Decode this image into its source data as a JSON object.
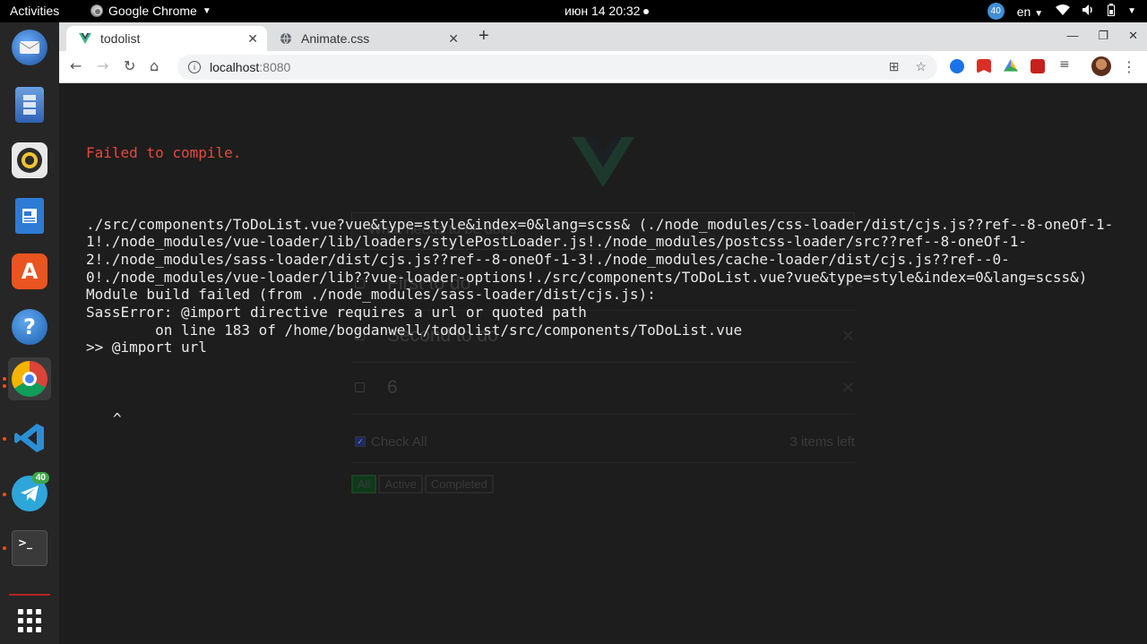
{
  "topbar": {
    "activities": "Activities",
    "app_name": "Google Chrome",
    "clock": "июн 14  20:32",
    "notifications": "40",
    "lang": "en"
  },
  "dock": {
    "telegram_badge": "40"
  },
  "browser": {
    "tabs": [
      {
        "title": "todolist"
      },
      {
        "title": "Animate.css"
      }
    ],
    "address_host": "localhost",
    "address_port": ":8080"
  },
  "app": {
    "input_placeholder": "What needs to be done",
    "items": [
      {
        "label": "First to do"
      },
      {
        "label": "Second to do"
      },
      {
        "label": "6"
      }
    ],
    "check_all": "Check All",
    "items_left": "3 items left",
    "filters": [
      "All",
      "Active",
      "Completed"
    ]
  },
  "error": {
    "title": "Failed to compile.",
    "message": "./src/components/ToDoList.vue?vue&type=style&index=0&lang=scss& (./node_modules/css-loader/dist/cjs.js??ref--8-oneOf-1-1!./node_modules/vue-loader/lib/loaders/stylePostLoader.js!./node_modules/postcss-loader/src??ref--8-oneOf-1-2!./node_modules/sass-loader/dist/cjs.js??ref--8-oneOf-1-3!./node_modules/cache-loader/dist/cjs.js??ref--0-0!./node_modules/vue-loader/lib??vue-loader-options!./src/components/ToDoList.vue?vue&type=style&index=0&lang=scss&)\nModule build failed (from ./node_modules/sass-loader/dist/cjs.js):\nSassError: @import directive requires a url or quoted path\n        on line 183 of /home/bogdanwell/todolist/src/components/ToDoList.vue\n>> @import url",
    "caret": "^"
  }
}
